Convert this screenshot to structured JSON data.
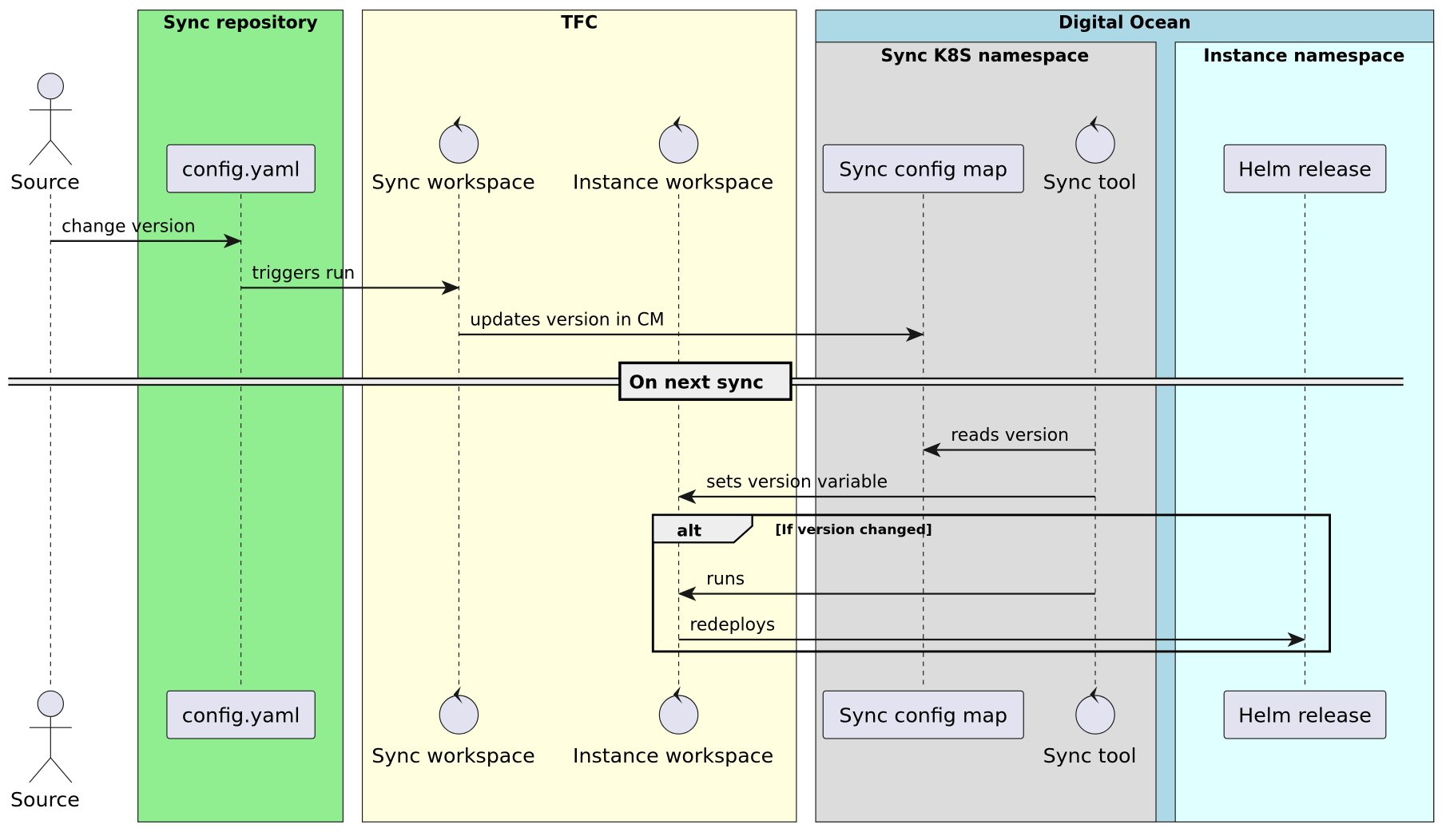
{
  "colors": {
    "sync_repository": "#90EE90",
    "tfc": "#FFFFE0",
    "digital_ocean": "#ADD8E6",
    "sync_k8s_namespace": "#DCDCDC",
    "instance_namespace": "#E0FFFF",
    "participant_fill": "#E2E2F0",
    "line": "#181818"
  },
  "boxes": {
    "sync_repository": "Sync repository",
    "tfc": "TFC",
    "digital_ocean": "Digital Ocean",
    "sync_k8s_namespace": "Sync K8S namespace",
    "instance_namespace": "Instance namespace"
  },
  "participants": [
    {
      "id": "source",
      "label": "Source",
      "type": "actor"
    },
    {
      "id": "config",
      "label": "config.yaml",
      "type": "participant"
    },
    {
      "id": "syncws",
      "label": "Sync workspace",
      "type": "control"
    },
    {
      "id": "instws",
      "label": "Instance workspace",
      "type": "control"
    },
    {
      "id": "synccm",
      "label": "Sync config map",
      "type": "participant"
    },
    {
      "id": "synctool",
      "label": "Sync tool",
      "type": "control"
    },
    {
      "id": "helm",
      "label": "Helm release",
      "type": "participant"
    }
  ],
  "messages": [
    {
      "from": "source",
      "to": "config",
      "label": "change version"
    },
    {
      "from": "config",
      "to": "syncws",
      "label": "triggers run"
    },
    {
      "from": "syncws",
      "to": "synccm",
      "label": "updates version in CM"
    },
    {
      "from": "synctool",
      "to": "synccm",
      "label": "reads version"
    },
    {
      "from": "synctool",
      "to": "instws",
      "label": "sets version variable"
    },
    {
      "from": "synctool",
      "to": "instws",
      "label": "runs"
    },
    {
      "from": "instws",
      "to": "helm",
      "label": "redeploys"
    }
  ],
  "divider": {
    "label": "On next sync"
  },
  "alt": {
    "label": "alt",
    "condition": "[If version changed]"
  }
}
